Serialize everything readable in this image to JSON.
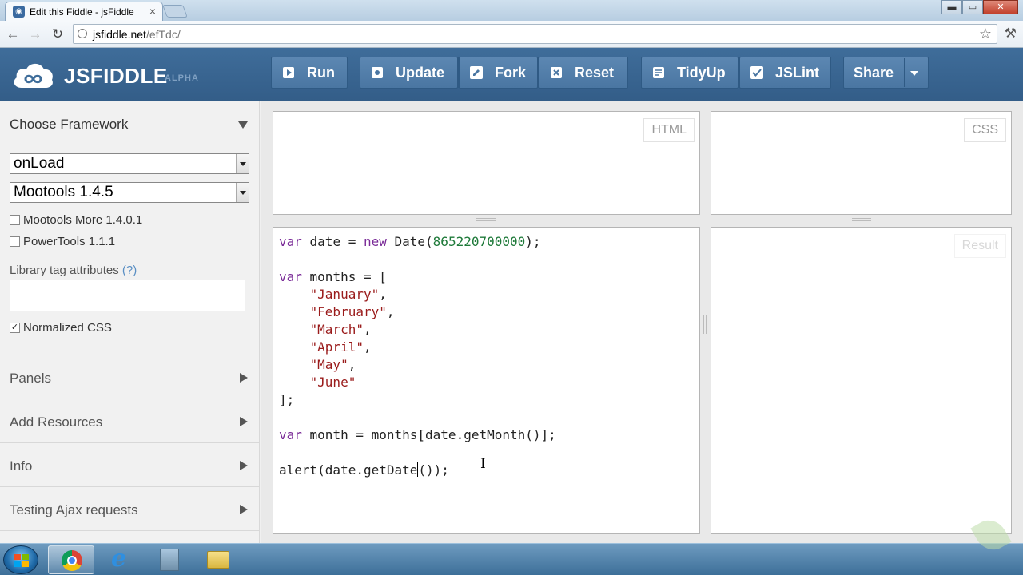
{
  "browser": {
    "tab_title": "Edit this Fiddle - jsFiddle",
    "tab_close": "×",
    "url_host": "jsfiddle.net",
    "url_path": "/efTdc/",
    "window_buttons": {
      "minimize": "▬",
      "maximize": "▭",
      "close": "✕"
    }
  },
  "header": {
    "logo_text": "JSFIDDLE",
    "logo_badge": "ALPHA",
    "buttons": {
      "run": "Run",
      "update": "Update",
      "fork": "Fork",
      "reset": "Reset",
      "tidyup": "TidyUp",
      "jslint": "JSLint",
      "share": "Share"
    }
  },
  "sidebar": {
    "title": "Choose Framework",
    "load_select": "onLoad",
    "framework_select": "Mootools 1.4.5",
    "checkboxes": [
      {
        "label": "Mootools More 1.4.0.1",
        "checked": false
      },
      {
        "label": "PowerTools 1.1.1",
        "checked": false
      }
    ],
    "library_label": "Library tag attributes",
    "library_help": "(?)",
    "normalized_css": {
      "label": "Normalized CSS",
      "checked": true
    },
    "sections": [
      "Panels",
      "Add Resources",
      "Info",
      "Testing Ajax requests"
    ]
  },
  "panels": {
    "html_label": "HTML",
    "css_label": "CSS",
    "result_label": "Result"
  },
  "code": {
    "l1": {
      "kw1": "var",
      "t1": " date = ",
      "kw2": "new",
      "t2": " Date(",
      "num": "865220700000",
      "t3": ");"
    },
    "l3": {
      "kw": "var",
      "t": " months = ["
    },
    "months": [
      "\"January\"",
      "\"February\"",
      "\"March\"",
      "\"April\"",
      "\"May\"",
      "\"June\""
    ],
    "l10": "];",
    "l12": {
      "kw": "var",
      "t": " month = months[date.getMonth()];"
    },
    "l14": {
      "a": "alert(date.getDate",
      "b": "());"
    }
  },
  "colors": {
    "header_bg": "#3f6d9a",
    "button_bg": "#5c87b2",
    "keyword": "#7a2b97",
    "string": "#9a1b1b",
    "number": "#1f7a3a"
  }
}
